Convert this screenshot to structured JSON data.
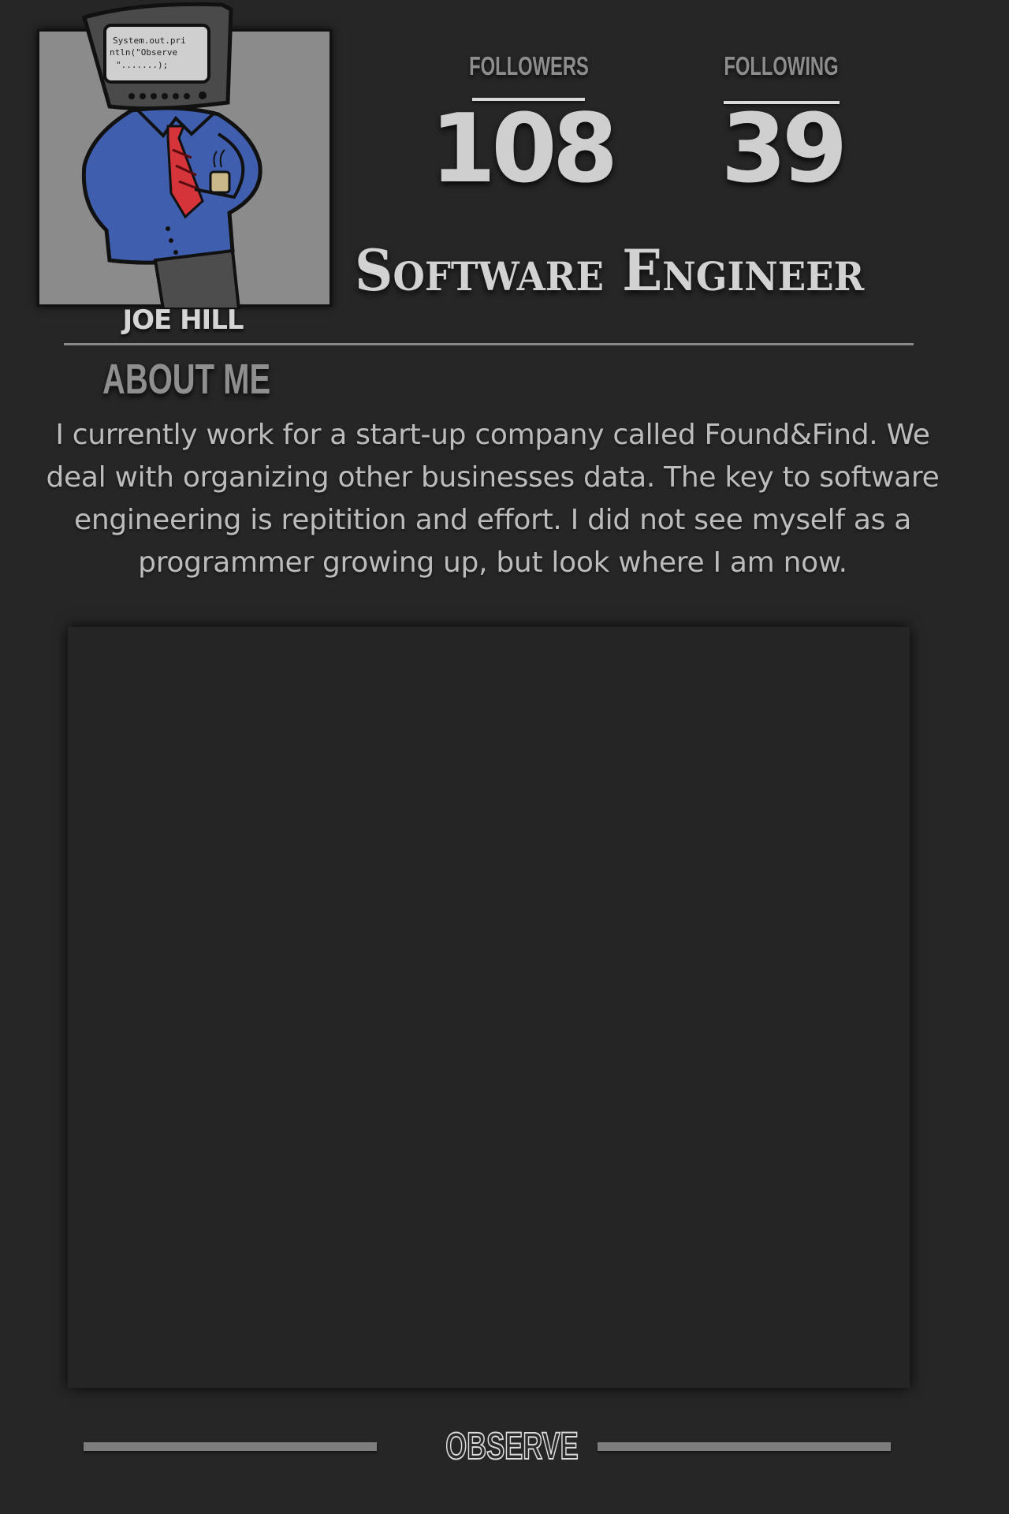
{
  "profile": {
    "name": "JOE HILL",
    "title": "Software Engineer",
    "avatar_screen_text": [
      "System.out.pri",
      "ntln(\"Observe",
      "\".......);"
    ]
  },
  "stats": {
    "followers_label": "FOLLOWERS",
    "followers_value": "108",
    "following_label": "FOLLOWING",
    "following_value": "39"
  },
  "about": {
    "heading": "ABOUT ME",
    "text": "I currently work for a start-up company called Found&Find. We deal with organizing other businesses data. The key to software engineering is repitition and effort. I did not see myself as a programmer growing up, but look where I am now."
  },
  "footer": {
    "observe_label": "OBSERVE"
  },
  "colors": {
    "background": "#262626",
    "panel": "#252525",
    "avatar_bg": "#8b8b8b",
    "shirt": "#3f5fae",
    "tie": "#d4343a"
  },
  "icons": {
    "avatar": "tv-head-programmer-illustration"
  }
}
